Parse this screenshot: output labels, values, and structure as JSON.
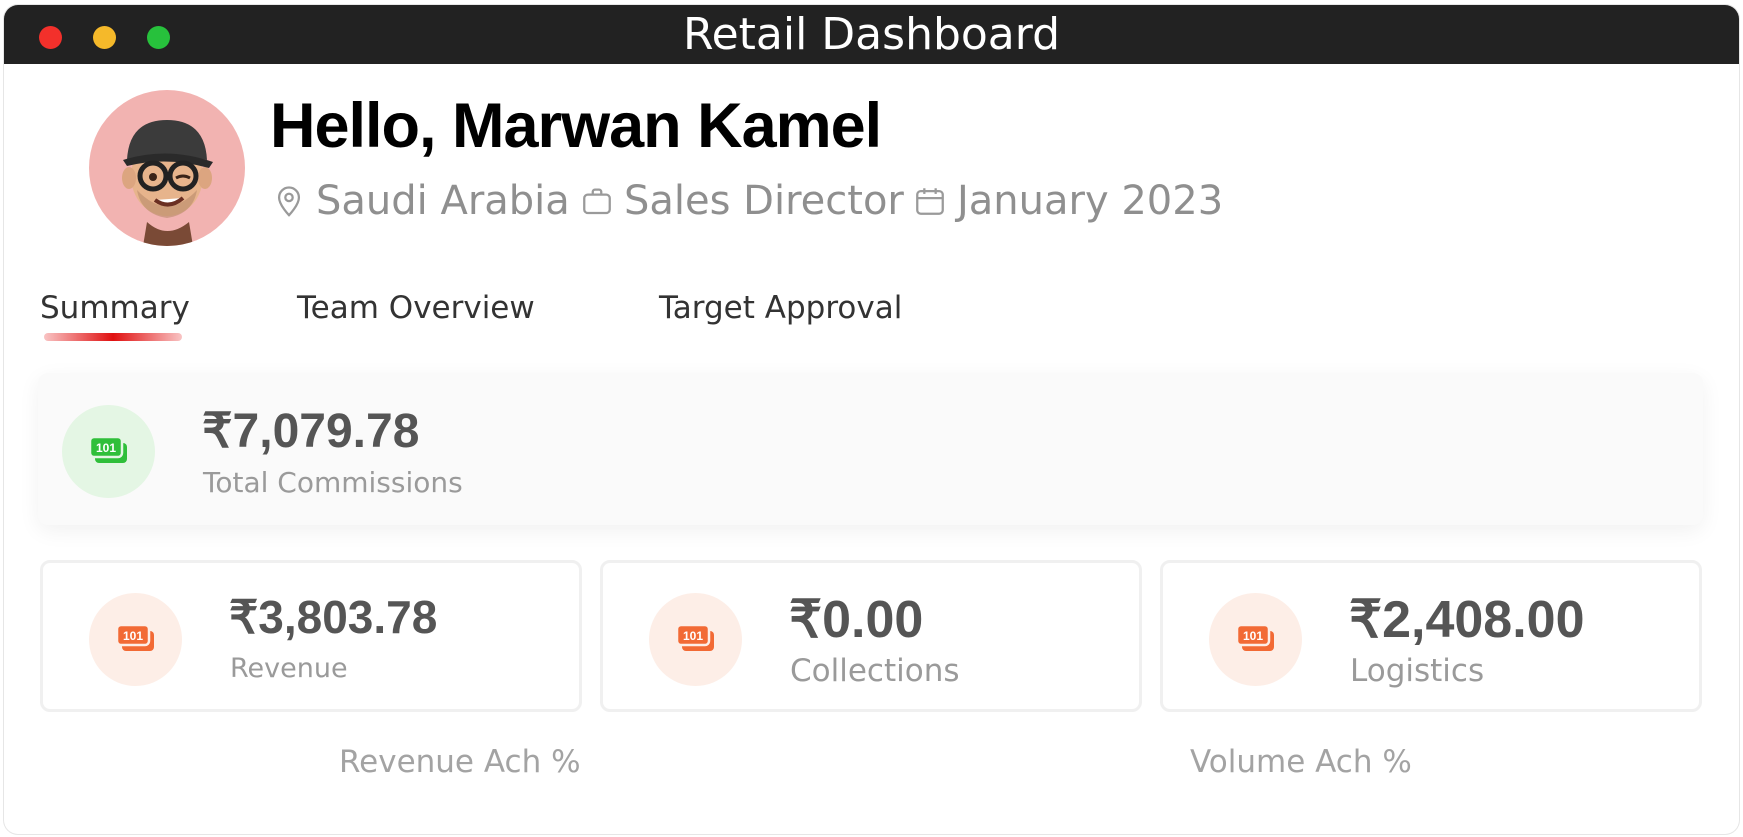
{
  "window": {
    "title": "Retail Dashboard"
  },
  "header": {
    "greeting": "Hello, Marwan Kamel",
    "location": "Saudi Arabia",
    "job_title": "Sales Director",
    "period": "January 2023"
  },
  "tabs": [
    {
      "label": "Summary",
      "active": true
    },
    {
      "label": "Team Overview",
      "active": false
    },
    {
      "label": "Target Approval",
      "active": false
    }
  ],
  "total": {
    "value": "₹7,079.78",
    "label": "Total Commissions"
  },
  "cards": [
    {
      "value": "₹3,803.78",
      "label": "Revenue"
    },
    {
      "value": "₹0.00",
      "label": "Collections"
    },
    {
      "value": "₹2,408.00",
      "label": "Logistics"
    }
  ],
  "achievement": {
    "revenue_label": "Revenue Ach %",
    "volume_label": "Volume Ach %"
  },
  "icons": {
    "location": "map-pin-icon",
    "job": "briefcase-icon",
    "date": "calendar-icon",
    "money": "money-stack-icon"
  },
  "colors": {
    "accent_red": "#e01010",
    "money_green": "#2fbf3a",
    "money_orange": "#f26a35",
    "avatar_bg": "#f2b3b1"
  }
}
